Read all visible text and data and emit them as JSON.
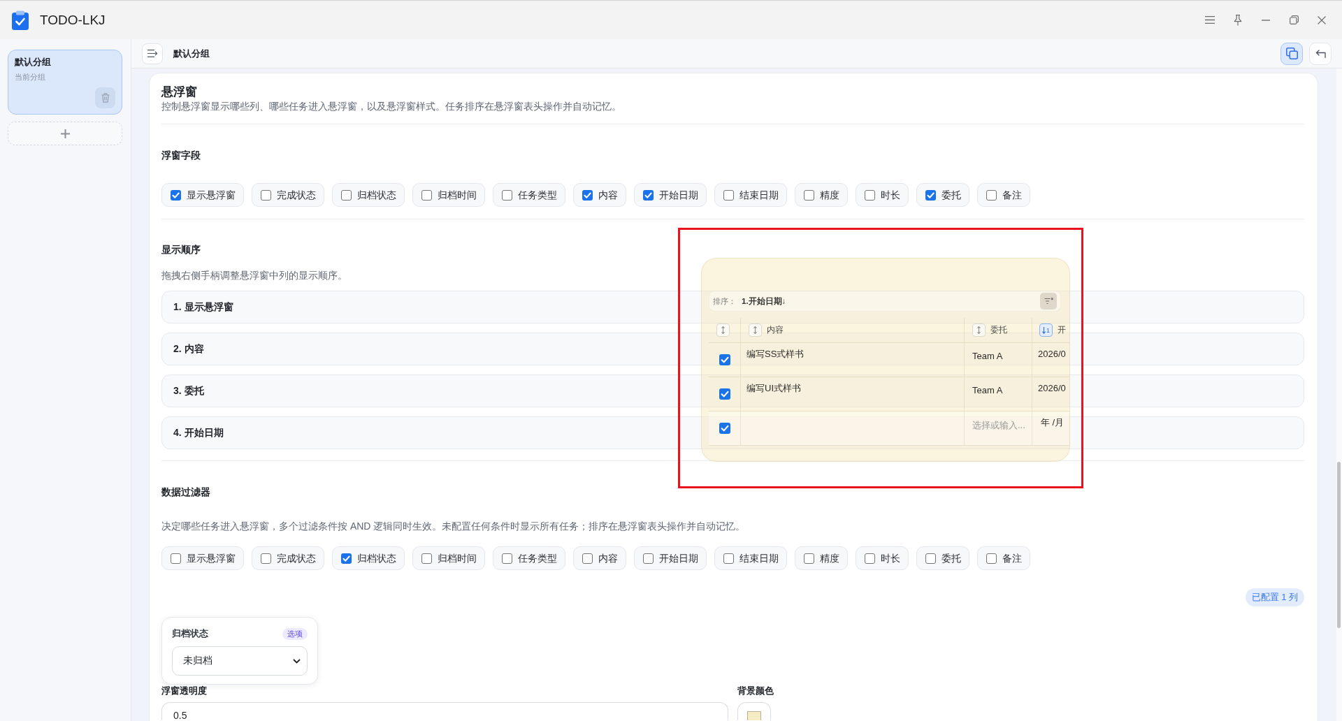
{
  "window": {
    "title": "TODO-LKJ"
  },
  "sidebar": {
    "groups": [
      {
        "name": "默认分组",
        "subtitle": "当前分组",
        "selected": true
      }
    ]
  },
  "header": {
    "title": "默认分组",
    "actions": [
      {
        "kind": "float",
        "active": true
      },
      {
        "kind": "back",
        "active": false
      }
    ]
  },
  "settings": {
    "title": "悬浮窗",
    "description": "控制悬浮窗显示哪些列、哪些任务进入悬浮窗，以及悬浮窗样式。任务排序在悬浮窗表头操作并自动记忆。",
    "fields": {
      "title": "浮窗字段",
      "options": [
        {
          "label": "显示悬浮窗",
          "checked": true
        },
        {
          "label": "完成状态",
          "checked": false
        },
        {
          "label": "归档状态",
          "checked": false
        },
        {
          "label": "归档时间",
          "checked": false
        },
        {
          "label": "任务类型",
          "checked": false
        },
        {
          "label": "内容",
          "checked": true
        },
        {
          "label": "开始日期",
          "checked": true
        },
        {
          "label": "结束日期",
          "checked": false
        },
        {
          "label": "精度",
          "checked": false
        },
        {
          "label": "时长",
          "checked": false
        },
        {
          "label": "委托",
          "checked": true
        },
        {
          "label": "备注",
          "checked": false
        }
      ]
    },
    "order": {
      "title": "显示顺序",
      "description": "拖拽右侧手柄调整悬浮窗中列的显示顺序。",
      "items": [
        {
          "label": "1. 显示悬浮窗"
        },
        {
          "label": "2. 内容"
        },
        {
          "label": "3. 委托"
        },
        {
          "label": "4. 开始日期"
        }
      ]
    },
    "filters": {
      "title": "数据过滤器",
      "description": "决定哪些任务进入悬浮窗，多个过滤条件按 AND 逻辑同时生效。未配置任何条件时显示所有任务；排序在悬浮窗表头操作并自动记忆。",
      "options": [
        {
          "label": "显示悬浮窗",
          "checked": false
        },
        {
          "label": "完成状态",
          "checked": false
        },
        {
          "label": "归档状态",
          "checked": true
        },
        {
          "label": "归档时间",
          "checked": false
        },
        {
          "label": "任务类型",
          "checked": false
        },
        {
          "label": "内容",
          "checked": false
        },
        {
          "label": "开始日期",
          "checked": false
        },
        {
          "label": "结束日期",
          "checked": false
        },
        {
          "label": "精度",
          "checked": false
        },
        {
          "label": "时长",
          "checked": false
        },
        {
          "label": "委托",
          "checked": false
        },
        {
          "label": "备注",
          "checked": false
        }
      ],
      "badge": "已配置 1 列",
      "conditions": [
        {
          "label": "归档状态",
          "tag": "选项",
          "value": "未归档"
        }
      ]
    },
    "opacity": {
      "label": "浮窗透明度",
      "value": "0.5"
    },
    "background_color": {
      "label": "背景颜色",
      "color": "#f6ecc4"
    }
  },
  "preview": {
    "sort_label": "排序：",
    "sort_value": "1.开始日期↓",
    "columns": [
      {
        "kind": "check",
        "sorted": false
      },
      {
        "kind": "text",
        "label": "内容",
        "sorted": false
      },
      {
        "kind": "text",
        "label": "委托",
        "sorted": false
      },
      {
        "kind": "text",
        "label": "开",
        "sorted": true,
        "descending": true,
        "sort_rank": "1"
      }
    ],
    "rows": [
      {
        "kind": "task",
        "checked": true,
        "cells": [
          "编写SS式样书",
          "Team A",
          "2026/0"
        ]
      },
      {
        "kind": "task",
        "checked": true,
        "cells": [
          "编写UI式样书",
          "Team A",
          "2026/0"
        ]
      },
      {
        "kind": "new",
        "checked": true,
        "placeholder": "选择或输入...",
        "date": "年 /月"
      }
    ]
  },
  "annotation": {
    "kind": "frame"
  }
}
